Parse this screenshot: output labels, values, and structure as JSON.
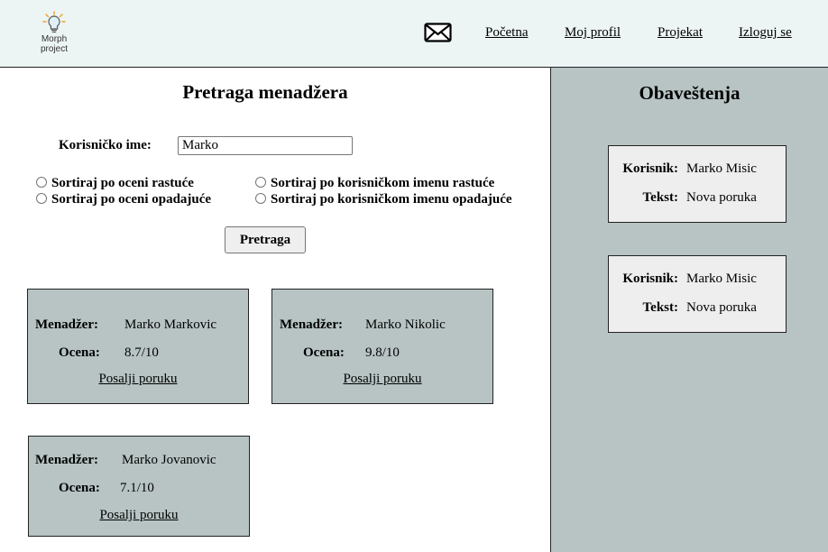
{
  "header": {
    "logo_text": "Morph\nproject",
    "nav": [
      "Početna",
      "Moj profil",
      "Projekat",
      "Izloguj se"
    ]
  },
  "search": {
    "title": "Pretraga menadžera",
    "username_label": "Korisničko ime:",
    "username_value": "Marko",
    "sort_options": [
      "Sortiraj po oceni rastuće",
      "Sortiraj po oceni opadajuće",
      "Sortiraj po korisničkom imenu rastuće",
      "Sortiraj po korisničkom imenu opadajuće"
    ],
    "button_label": "Pretraga"
  },
  "labels": {
    "manager": "Menadžer:",
    "rating": "Ocena:",
    "send_message": "Posalji poruku",
    "user": "Korisnik:",
    "text": "Tekst:"
  },
  "managers": [
    {
      "name": "Marko Markovic",
      "rating": "8.7/10"
    },
    {
      "name": "Marko Nikolic",
      "rating": "9.8/10"
    },
    {
      "name": "Marko Jovanovic",
      "rating": "7.1/10"
    }
  ],
  "notifications": {
    "title": "Obaveštenja",
    "items": [
      {
        "user": "Marko Misic",
        "text": "Nova poruka"
      },
      {
        "user": "Marko Misic",
        "text": "Nova poruka"
      }
    ]
  },
  "colors": {
    "header_bg": "#edf4f4",
    "panel_bg": "#b8c4c4",
    "notification_bg": "#eeeeee"
  },
  "icons": [
    "lightbulb-logo-icon",
    "mail-icon"
  ]
}
